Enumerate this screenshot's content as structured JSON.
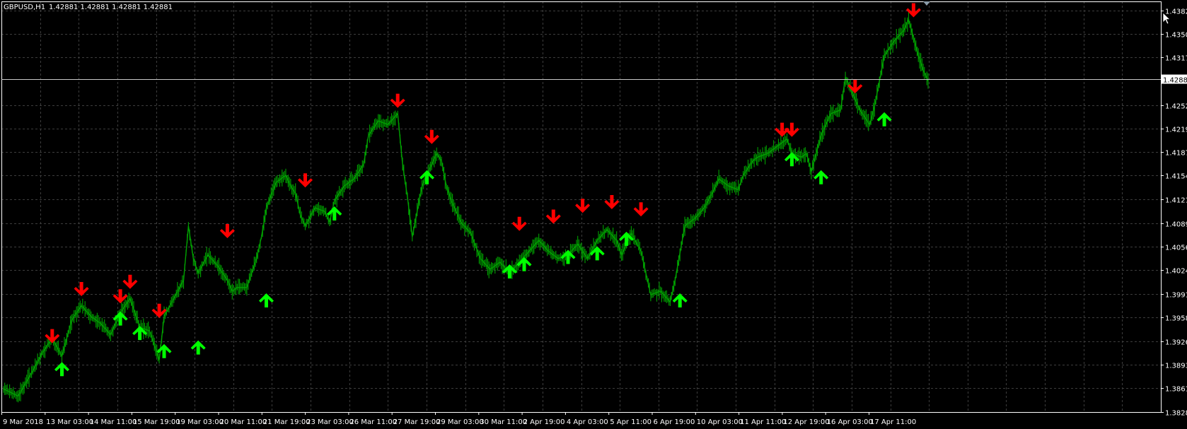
{
  "header": {
    "symbol_timeframe": "GBPUSD,H1",
    "ohlc": "1.42881 1.42881 1.42881 1.42881"
  },
  "colors": {
    "background": "#000000",
    "grid": "#3d3d3d",
    "axis": "#ffffff",
    "price_line": "#00a000",
    "up_arrow": "#00ff00",
    "down_arrow": "#ff0000",
    "current_line": "#c8c8c8"
  },
  "chart_data": {
    "type": "line",
    "symbol": "GBPUSD",
    "timeframe": "H1",
    "current_price": 1.42881,
    "current_price_label": "1.42881",
    "ylim": [
      1.3828,
      1.4395
    ],
    "y_ticks": [
      "1.43825",
      "1.43500",
      "1.43175",
      "1.42520",
      "1.42195",
      "1.41870",
      "1.41545",
      "1.41215",
      "1.40890",
      "1.40565",
      "1.40240",
      "1.39910",
      "1.39585",
      "1.39260",
      "1.38935",
      "1.38610",
      "1.38280"
    ],
    "x_ticks": [
      "9 Mar 2018",
      "13 Mar 03:00",
      "14 Mar 11:00",
      "15 Mar 19:00",
      "19 Mar 03:00",
      "20 Mar 11:00",
      "21 Mar 19:00",
      "23 Mar 03:00",
      "26 Mar 11:00",
      "27 Mar 19:00",
      "29 Mar 03:00",
      "30 Mar 11:00",
      "2 Apr 19:00",
      "4 Apr 03:00",
      "5 Apr 11:00",
      "6 Apr 19:00",
      "10 Apr 03:00",
      "11 Apr 11:00",
      "12 Apr 19:00",
      "16 Apr 03:00",
      "17 Apr 11:00"
    ],
    "series": [
      {
        "points": [
          [
            0,
            1.386
          ],
          [
            3,
            1.385
          ],
          [
            6,
            1.3885
          ],
          [
            8,
            1.391
          ],
          [
            10,
            1.393
          ],
          [
            12,
            1.3905
          ],
          [
            14,
            1.3955
          ],
          [
            16,
            1.3975
          ],
          [
            18,
            1.396
          ],
          [
            20,
            1.395
          ],
          [
            22,
            1.3935
          ],
          [
            24,
            1.3965
          ],
          [
            26,
            1.3985
          ],
          [
            28,
            1.3945
          ],
          [
            30,
            1.394
          ],
          [
            31,
            1.392
          ],
          [
            32,
            1.39
          ],
          [
            33,
            1.396
          ],
          [
            35,
            1.3985
          ],
          [
            37,
            1.401
          ],
          [
            38,
            1.4085
          ],
          [
            39,
            1.404
          ],
          [
            40,
            1.402
          ],
          [
            42,
            1.4045
          ],
          [
            44,
            1.403
          ],
          [
            46,
            1.401
          ],
          [
            47,
            1.3995
          ],
          [
            48,
            1.4
          ],
          [
            50,
            1.4
          ],
          [
            52,
            1.404
          ],
          [
            53,
            1.407
          ],
          [
            54,
            1.411
          ],
          [
            56,
            1.4145
          ],
          [
            58,
            1.4155
          ],
          [
            59,
            1.414
          ],
          [
            60,
            1.413
          ],
          [
            61,
            1.41
          ],
          [
            62,
            1.4085
          ],
          [
            64,
            1.411
          ],
          [
            66,
            1.4105
          ],
          [
            67,
            1.409
          ],
          [
            68,
            1.412
          ],
          [
            70,
            1.414
          ],
          [
            72,
            1.415
          ],
          [
            74,
            1.417
          ],
          [
            75,
            1.421
          ],
          [
            77,
            1.423
          ],
          [
            79,
            1.4225
          ],
          [
            81,
            1.424
          ],
          [
            82,
            1.417
          ],
          [
            83,
            1.4125
          ],
          [
            84,
            1.407
          ],
          [
            85,
            1.4105
          ],
          [
            86,
            1.414
          ],
          [
            88,
            1.417
          ],
          [
            89,
            1.4185
          ],
          [
            90,
            1.4175
          ],
          [
            91,
            1.414
          ],
          [
            92,
            1.412
          ],
          [
            94,
            1.409
          ],
          [
            96,
            1.4075
          ],
          [
            98,
            1.404
          ],
          [
            100,
            1.4025
          ],
          [
            102,
            1.4035
          ],
          [
            104,
            1.402
          ],
          [
            106,
            1.4035
          ],
          [
            108,
            1.405
          ],
          [
            110,
            1.4065
          ],
          [
            112,
            1.405
          ],
          [
            114,
            1.404
          ],
          [
            116,
            1.4045
          ],
          [
            118,
            1.406
          ],
          [
            120,
            1.404
          ],
          [
            122,
            1.4065
          ],
          [
            124,
            1.408
          ],
          [
            126,
            1.4065
          ],
          [
            127,
            1.4045
          ],
          [
            129,
            1.4075
          ],
          [
            131,
            1.405
          ],
          [
            132,
            1.402
          ],
          [
            133,
            1.399
          ],
          [
            135,
            1.3995
          ],
          [
            137,
            1.398
          ],
          [
            138,
            1.401
          ],
          [
            140,
            1.4085
          ],
          [
            142,
            1.4095
          ],
          [
            144,
            1.411
          ],
          [
            146,
            1.4135
          ],
          [
            147,
            1.415
          ],
          [
            149,
            1.414
          ],
          [
            151,
            1.4135
          ],
          [
            152,
            1.4155
          ],
          [
            154,
            1.4175
          ],
          [
            155,
            1.418
          ],
          [
            157,
            1.4185
          ],
          [
            159,
            1.4195
          ],
          [
            161,
            1.4205
          ],
          [
            162,
            1.4185
          ],
          [
            164,
            1.418
          ],
          [
            165,
            1.4185
          ],
          [
            166,
            1.416
          ],
          [
            168,
            1.421
          ],
          [
            170,
            1.424
          ],
          [
            172,
            1.4245
          ],
          [
            173,
            1.429
          ],
          [
            174,
            1.4275
          ],
          [
            175,
            1.426
          ],
          [
            176,
            1.4245
          ],
          [
            177,
            1.4235
          ],
          [
            178,
            1.4225
          ],
          [
            179,
            1.425
          ],
          [
            181,
            1.432
          ],
          [
            183,
            1.434
          ],
          [
            185,
            1.4355
          ],
          [
            186,
            1.437
          ],
          [
            187,
            1.4345
          ],
          [
            188,
            1.432
          ],
          [
            189,
            1.43
          ],
          [
            190,
            1.4285
          ]
        ]
      }
    ],
    "down_arrows": [
      [
        10,
        1.3925
      ],
      [
        16,
        1.399
      ],
      [
        24,
        1.398
      ],
      [
        26,
        1.4
      ],
      [
        32,
        1.396
      ],
      [
        46,
        1.407
      ],
      [
        62,
        1.414
      ],
      [
        81,
        1.425
      ],
      [
        88,
        1.42
      ],
      [
        106,
        1.408
      ],
      [
        113,
        1.409
      ],
      [
        119,
        1.4105
      ],
      [
        125,
        1.411
      ],
      [
        131,
        1.41
      ],
      [
        160,
        1.421
      ],
      [
        162,
        1.421
      ],
      [
        175,
        1.427
      ],
      [
        187,
        1.4375
      ]
    ],
    "up_arrows": [
      [
        12,
        1.3895
      ],
      [
        24,
        1.3965
      ],
      [
        28,
        1.3945
      ],
      [
        33,
        1.392
      ],
      [
        40,
        1.3925
      ],
      [
        54,
        1.399
      ],
      [
        68,
        1.411
      ],
      [
        87,
        1.416
      ],
      [
        104,
        1.403
      ],
      [
        107,
        1.404
      ],
      [
        116,
        1.405
      ],
      [
        122,
        1.4055
      ],
      [
        128,
        1.4075
      ],
      [
        139,
        1.399
      ],
      [
        162,
        1.4185
      ],
      [
        168,
        1.416
      ],
      [
        181,
        1.424
      ]
    ]
  }
}
